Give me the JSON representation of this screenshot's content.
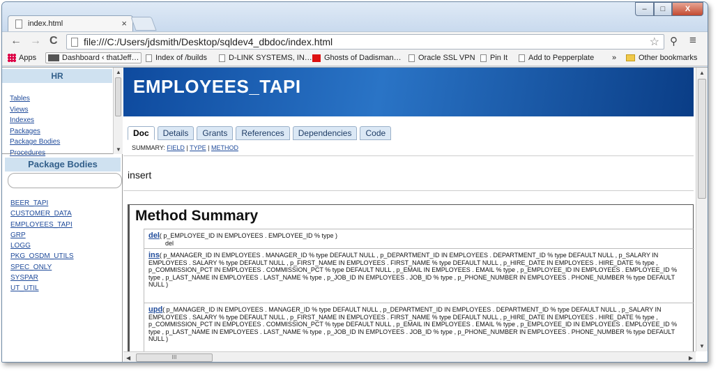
{
  "browser": {
    "tab_title": "index.html",
    "tab_close": "×",
    "url": "file:///C:/Users/jdsmith/Desktop/sqldev4_dbdoc/index.html",
    "window_controls": {
      "minimize": "–",
      "maximize": "□",
      "close": "X"
    },
    "nav": {
      "back": "←",
      "forward": "→",
      "reload": "C"
    },
    "toolbar_icons": {
      "star": "☆",
      "menu": "≡",
      "extension": "⚲"
    }
  },
  "bookmarks": {
    "apps": "Apps",
    "items": [
      "Dashboard ‹ thatJeff…",
      "Index of /builds",
      "D-LINK SYSTEMS, IN…",
      "Ghosts of Dadisman…",
      "Oracle SSL VPN",
      "Pin It",
      "Add to Pepperplate"
    ],
    "overflow": "»",
    "other": "Other bookmarks"
  },
  "left_top": {
    "heading": "HR",
    "links": [
      "Tables",
      "Views",
      "Indexes",
      "Packages",
      "Package Bodies",
      "Procedures"
    ]
  },
  "left_bottom": {
    "heading": "Package Bodies",
    "search_value": "",
    "links": [
      "BEER_TAPI",
      "CUSTOMER_DATA",
      "EMPLOYEES_TAPI",
      "GRP",
      "LOGG",
      "PKG_OSDM_UTILS",
      "SPEC_ONLY",
      "SYSPAR",
      "UT_UTIL"
    ]
  },
  "main": {
    "title": "EMPLOYEES_TAPI",
    "tabs": [
      "Doc",
      "Details",
      "Grants",
      "References",
      "Dependencies",
      "Code"
    ],
    "summary": {
      "label": "SUMMARY:",
      "field": "FIELD",
      "sep": "|",
      "type": "TYPE",
      "method": "METHOD"
    },
    "description": "insert",
    "method_summary_title": "Method Summary",
    "methods": [
      {
        "name": "del",
        "signature": "( p_EMPLOYEE_ID IN EMPLOYEES . EMPLOYEE_ID % type )",
        "desc": "del"
      },
      {
        "name": "ins",
        "signature": "( p_MANAGER_ID IN EMPLOYEES . MANAGER_ID % type DEFAULT NULL , p_DEPARTMENT_ID IN EMPLOYEES . DEPARTMENT_ID % type DEFAULT NULL , p_SALARY IN EMPLOYEES . SALARY % type DEFAULT NULL , p_FIRST_NAME IN EMPLOYEES . FIRST_NAME % type DEFAULT NULL , p_HIRE_DATE IN EMPLOYEES . HIRE_DATE % type , p_COMMISSION_PCT IN EMPLOYEES . COMMISSION_PCT % type DEFAULT NULL , p_EMAIL IN EMPLOYEES . EMAIL % type , p_EMPLOYEE_ID IN EMPLOYEES . EMPLOYEE_ID % type , p_LAST_NAME IN EMPLOYEES . LAST_NAME % type , p_JOB_ID IN EMPLOYEES . JOB_ID % type , p_PHONE_NUMBER IN EMPLOYEES . PHONE_NUMBER % type DEFAULT NULL )"
      },
      {
        "name": "upd",
        "signature": "( p_MANAGER_ID IN EMPLOYEES . MANAGER_ID % type DEFAULT NULL , p_DEPARTMENT_ID IN EMPLOYEES . DEPARTMENT_ID % type DEFAULT NULL , p_SALARY IN EMPLOYEES . SALARY % type DEFAULT NULL , p_FIRST_NAME IN EMPLOYEES . FIRST_NAME % type DEFAULT NULL , p_HIRE_DATE IN EMPLOYEES . HIRE_DATE % type , p_COMMISSION_PCT IN EMPLOYEES . COMMISSION_PCT % type DEFAULT NULL , p_EMAIL IN EMPLOYEES . EMAIL % type , p_EMPLOYEE_ID IN EMPLOYEES . EMPLOYEE_ID % type , p_LAST_NAME IN EMPLOYEES . LAST_NAME % type , p_JOB_ID IN EMPLOYEES . JOB_ID % type , p_PHONE_NUMBER IN EMPLOYEES . PHONE_NUMBER % type DEFAULT NULL )"
      }
    ]
  },
  "scroll": {
    "hthumb": "III"
  },
  "colors": {
    "banner": "#1a5cb0",
    "link": "#1e4a9a",
    "pane_header": "#cfe1f0"
  }
}
